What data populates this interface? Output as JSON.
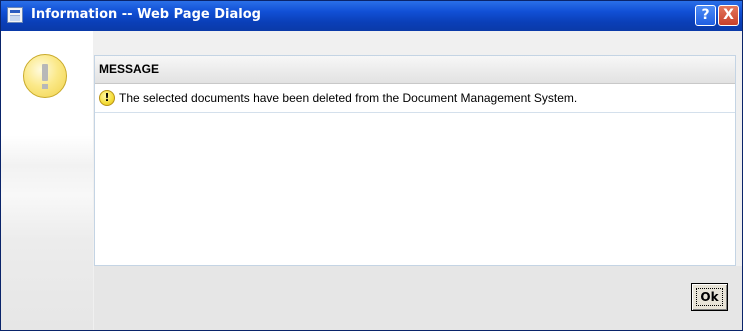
{
  "window": {
    "title": "Information -- Web Page Dialog",
    "help_label": "?",
    "close_label": "X"
  },
  "message_panel": {
    "header": "MESSAGE",
    "icon_label": "!",
    "text": "The selected documents have been deleted from the Document Management System."
  },
  "actions": {
    "ok_label": "Ok"
  },
  "colors": {
    "titlebar": "#0a3fb8",
    "warning": "#f1d24a"
  },
  "icons": {
    "title": "dialog-window-icon",
    "large": "warning-icon",
    "small": "warning-icon"
  }
}
